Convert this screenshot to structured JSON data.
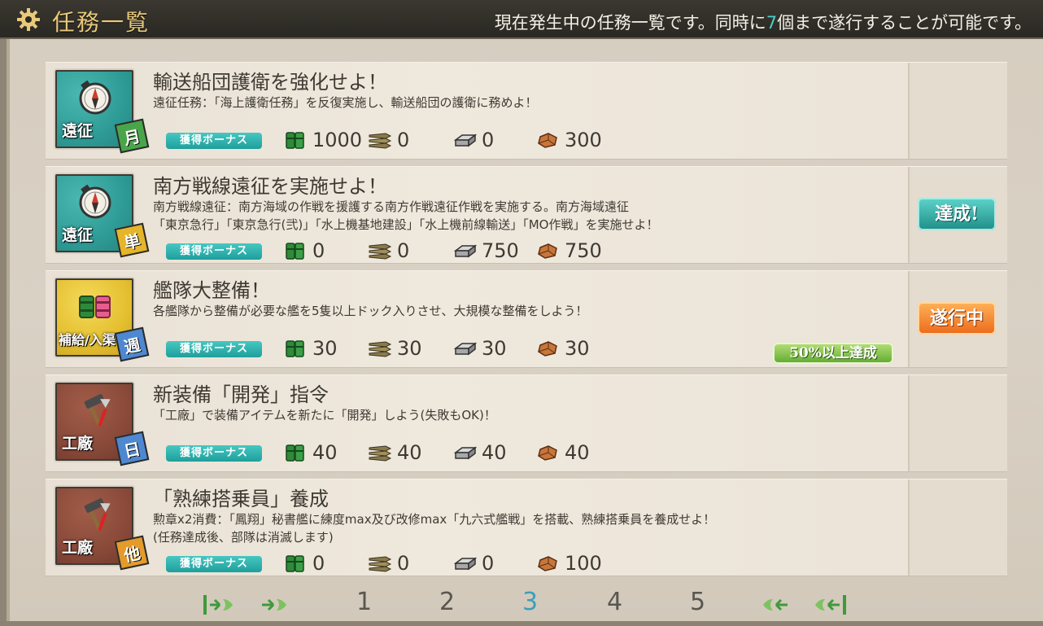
{
  "header": {
    "title": "任務一覧",
    "desc_pre": "現在発生中の任務一覧です。同時に",
    "desc_num": "7",
    "desc_post": "個まで遂行することが可能です。"
  },
  "bonus_label": "獲得ボーナス",
  "quests": [
    {
      "category": "遠征",
      "frequency": "月",
      "title": "輸送船団護衛を強化せよ！",
      "desc": [
        "遠征任務：「海上護衛任務」を反復実施し、輸送船団の護衛に務めよ！"
      ],
      "fuel": "1000",
      "ammo": "0",
      "steel": "0",
      "bauxite": "300",
      "status": ""
    },
    {
      "category": "遠征",
      "frequency": "単",
      "title": "南方戦線遠征を実施せよ！",
      "desc": [
        "南方戦線遠征：南方海域の作戦を援護する南方作戦遠征作戦を実施する。南方海域遠征",
        "「東京急行」「東京急行(弐)」「水上機基地建設」「水上機前線輸送」「MO作戦」を実施せよ！"
      ],
      "fuel": "0",
      "ammo": "0",
      "steel": "750",
      "bauxite": "750",
      "status": "達成!"
    },
    {
      "category": "補給/入渠",
      "frequency": "週",
      "title": "艦隊大整備！",
      "desc": [
        "各艦隊から整備が必要な艦を5隻以上ドック入りさせ、大規模な整備をしよう！"
      ],
      "fuel": "30",
      "ammo": "30",
      "steel": "30",
      "bauxite": "30",
      "status": "遂行中",
      "progress": "50%以上達成"
    },
    {
      "category": "工廠",
      "frequency": "日",
      "title": "新装備「開発」指令",
      "desc": [
        "「工廠」で装備アイテムを新たに「開発」しよう(失敗もOK)！"
      ],
      "fuel": "40",
      "ammo": "40",
      "steel": "40",
      "bauxite": "40",
      "status": ""
    },
    {
      "category": "工廠",
      "frequency": "他",
      "title": "「熟練搭乗員」養成",
      "desc": [
        "勲章x2消費：「鳳翔」秘書艦に練度max及び改修max「九六式艦戦」を搭載、熟練搭乗員を養成せよ！",
        "(任務達成後、部隊は消滅します)"
      ],
      "fuel": "0",
      "ammo": "0",
      "steel": "0",
      "bauxite": "100",
      "status": ""
    }
  ],
  "pagination": {
    "pages": [
      "1",
      "2",
      "3",
      "4",
      "5"
    ],
    "current": "3"
  },
  "colors": {
    "accent": "#3aa0b8",
    "header_bg": "#2a2823",
    "title_gold": "#e9c97a",
    "done": "#1e8e88",
    "in_progress": "#ec6a1a"
  },
  "icons": {
    "expedition": "compass-icon",
    "supply": "supply-drums-icon",
    "factory": "hammer-icon",
    "fuel": "fuel-icon",
    "ammo": "ammo-icon",
    "steel": "steel-icon",
    "bauxite": "bauxite-icon"
  }
}
